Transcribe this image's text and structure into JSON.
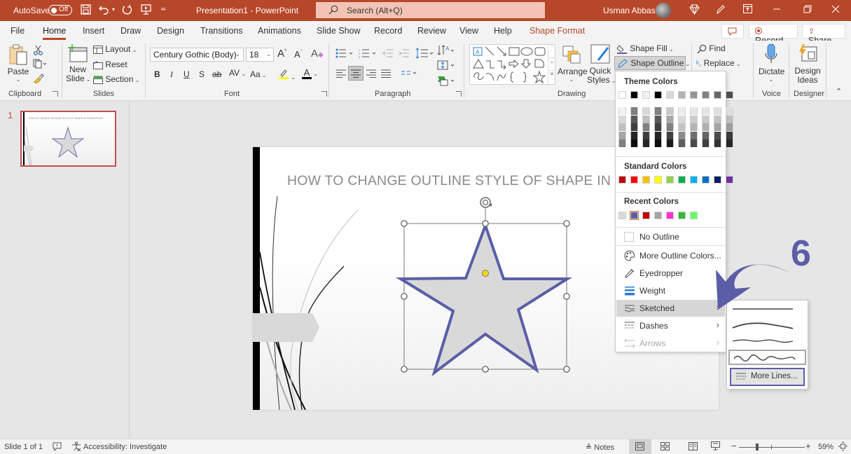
{
  "titlebar": {
    "autosave_label": "AutoSave",
    "autosave_state": "Off",
    "doc_title": "Presentation1  -  PowerPoint",
    "search_placeholder": "Search (Alt+Q)",
    "user_name": "Usman Abbasi",
    "accent_color": "#b7472a"
  },
  "tabs": [
    {
      "label": "File"
    },
    {
      "label": "Home",
      "active": true
    },
    {
      "label": "Insert"
    },
    {
      "label": "Draw"
    },
    {
      "label": "Design"
    },
    {
      "label": "Transitions"
    },
    {
      "label": "Animations"
    },
    {
      "label": "Slide Show"
    },
    {
      "label": "Record"
    },
    {
      "label": "Review"
    },
    {
      "label": "View"
    },
    {
      "label": "Help"
    },
    {
      "label": "Shape Format",
      "contextual": true
    }
  ],
  "tab_right": {
    "record_label": "Record",
    "share_label": "Share"
  },
  "ribbon": {
    "clipboard": {
      "label": "Clipboard",
      "paste": "Paste"
    },
    "slides": {
      "label": "Slides",
      "new_slide_1": "New",
      "new_slide_2": "Slide",
      "layout": "Layout",
      "reset": "Reset",
      "section": "Section"
    },
    "font": {
      "label": "Font",
      "font_name": "Century Gothic (Body)",
      "font_size": "18",
      "bold": "B",
      "italic": "I",
      "underline": "U",
      "shadow": "S",
      "strike": "ab",
      "spacing": "AV",
      "change_case": "Aa"
    },
    "paragraph": {
      "label": "Paragraph"
    },
    "drawing": {
      "label": "Drawing",
      "arrange": "Arrange",
      "quick_styles_1": "Quick",
      "quick_styles_2": "Styles",
      "shape_fill": "Shape Fill",
      "shape_outline": "Shape Outline"
    },
    "editing": {
      "label": "Editing",
      "find": "Find",
      "replace": "Replace"
    },
    "voice": {
      "label": "Voice",
      "dictate": "Dictate"
    },
    "designer": {
      "label": "Designer",
      "design_ideas_1": "Design",
      "design_ideas_2": "Ideas"
    }
  },
  "thumbnails": [
    {
      "number": "1",
      "title": "HOW TO CHANGE OUTLINE STYLE OF SHAPE IN POWERPOINT"
    }
  ],
  "slide": {
    "title": "HOW TO CHANGE OUTLINE  STYLE OF SHAPE IN POWERPOINT",
    "star_fill": "#d9d9d9",
    "star_outline": "#5b5ea6"
  },
  "dropdown": {
    "theme_colors_label": "Theme Colors",
    "theme_top_row": [
      "#ffffff",
      "#000000",
      "#f2f2f2",
      "#000000",
      "#d9d9d9",
      "#b3b3b3",
      "#959595",
      "#808080",
      "#666666",
      "#4d4d4d"
    ],
    "theme_shades": [
      [
        "#f2f2f2",
        "#d9d9d9",
        "#bfbfbf",
        "#a6a6a6",
        "#808080"
      ],
      [
        "#7f7f7f",
        "#595959",
        "#3f3f3f",
        "#262626",
        "#0d0d0d"
      ],
      [
        "#d9d9d9",
        "#bfbfbf",
        "#808080",
        "#3f3f3f",
        "#262626"
      ],
      [
        "#7f7f7f",
        "#595959",
        "#3f3f3f",
        "#262626",
        "#0d0d0d"
      ],
      [
        "#c8c8c8",
        "#a6a6a6",
        "#808080",
        "#404040",
        "#1a1a1a"
      ],
      [
        "#ececec",
        "#dadada",
        "#c4c4c4",
        "#8c8c8c",
        "#5e5e5e"
      ],
      [
        "#e6e6e6",
        "#cccccc",
        "#b3b3b3",
        "#6e6e6e",
        "#494949"
      ],
      [
        "#e5e5e5",
        "#cbcbcb",
        "#b0b0b0",
        "#666666",
        "#404040"
      ],
      [
        "#e0e0e0",
        "#c2c2c2",
        "#a3a3a3",
        "#4d4d4d",
        "#333333"
      ],
      [
        "#dedede",
        "#bdbdbd",
        "#9c9c9c",
        "#3a3a3a",
        "#262626"
      ]
    ],
    "standard_colors_label": "Standard Colors",
    "standard_colors": [
      "#c00000",
      "#ff0000",
      "#ffc000",
      "#ffff00",
      "#92d050",
      "#00b050",
      "#00b0f0",
      "#0070c0",
      "#002060",
      "#7030a0"
    ],
    "recent_colors_label": "Recent Colors",
    "recent_colors": [
      "#d9d9d9",
      "#5b5ea6",
      "#c00000",
      "#a6a6a6",
      "#ff33cc",
      "#33bb33",
      "#66ff66"
    ],
    "items": [
      {
        "label": "No Outline",
        "icon": "no-outline-icon"
      },
      {
        "label": "More Outline Colors...",
        "icon": "palette-icon"
      },
      {
        "label": "Eyedropper",
        "icon": "eyedropper-icon"
      },
      {
        "label": "Weight",
        "icon": "weight-icon"
      },
      {
        "label": "Sketched",
        "icon": "sketched-icon",
        "highlighted": true,
        "submenu": true
      },
      {
        "label": "Dashes",
        "icon": "dashes-icon",
        "submenu": true
      },
      {
        "label": "Arrows",
        "icon": "arrows-icon",
        "disabled": true,
        "submenu": true
      }
    ]
  },
  "submenu": {
    "options": [
      "straight",
      "curved",
      "freehand",
      "scribble"
    ],
    "selected": "scribble",
    "more_lines_label": "More Lines..."
  },
  "annotation": {
    "step_number": "6",
    "color": "#5b5ea6"
  },
  "statusbar": {
    "slide_info": "Slide 1 of 1",
    "accessibility": "Accessibility: Investigate",
    "notes": "Notes",
    "zoom": "59%"
  }
}
